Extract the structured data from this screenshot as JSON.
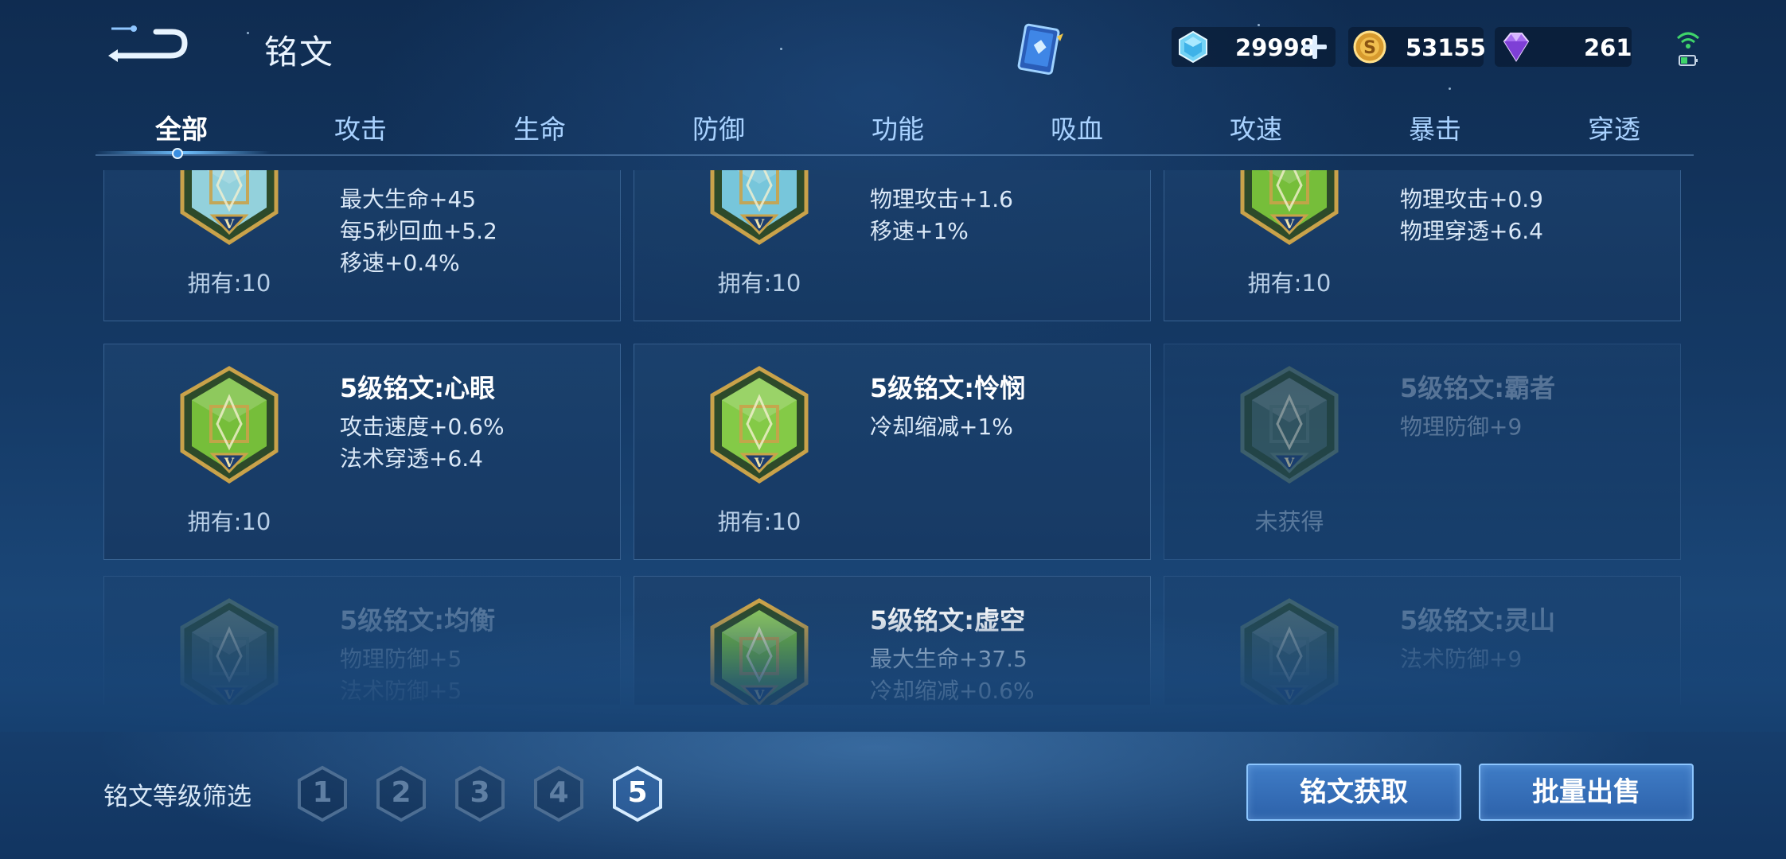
{
  "header": {
    "title": "铭文",
    "currencies": [
      {
        "name": "diamond",
        "icon": "diamond-icon",
        "value": "29998",
        "has_plus": true
      },
      {
        "name": "gold",
        "icon": "gold-coin-icon",
        "value": "53155",
        "has_plus": false
      },
      {
        "name": "gem",
        "icon": "purple-gem-icon",
        "value": "261",
        "has_plus": false
      }
    ]
  },
  "tabs": [
    {
      "label": "全部",
      "active": true
    },
    {
      "label": "攻击",
      "active": false
    },
    {
      "label": "生命",
      "active": false
    },
    {
      "label": "防御",
      "active": false
    },
    {
      "label": "功能",
      "active": false
    },
    {
      "label": "吸血",
      "active": false
    },
    {
      "label": "攻速",
      "active": false
    },
    {
      "label": "暴击",
      "active": false
    },
    {
      "label": "穿透",
      "active": false
    }
  ],
  "cards": [
    {
      "name": "",
      "attrs": [
        "最大生命+45",
        "每5秒回血+5.2",
        "移速+0.4%"
      ],
      "owned": "拥有:10",
      "obtained": true,
      "gem_color": "#9fe0f0"
    },
    {
      "name": "",
      "attrs": [
        "物理攻击+1.6",
        "移速+1%"
      ],
      "owned": "拥有:10",
      "obtained": true,
      "gem_color": "#7fd4ee"
    },
    {
      "name": "",
      "attrs": [
        "物理攻击+0.9",
        "物理穿透+6.4"
      ],
      "owned": "拥有:10",
      "obtained": true,
      "gem_color": "#7ecb3c"
    },
    {
      "name": "5级铭文:心眼",
      "attrs": [
        "攻击速度+0.6%",
        "法术穿透+6.4"
      ],
      "owned": "拥有:10",
      "obtained": true,
      "gem_color": "#7ecb3c"
    },
    {
      "name": "5级铭文:怜悯",
      "attrs": [
        "冷却缩减+1%"
      ],
      "owned": "拥有:10",
      "obtained": true,
      "gem_color": "#8ed84a"
    },
    {
      "name": "5级铭文:霸者",
      "attrs": [
        "物理防御+9"
      ],
      "owned": "未获得",
      "obtained": false,
      "gem_color": "#4a6a60"
    },
    {
      "name": "5级铭文:均衡",
      "attrs": [
        "物理防御+5",
        "法术防御+5"
      ],
      "owned": "",
      "obtained": false,
      "gem_color": "#4a6a60"
    },
    {
      "name": "5级铭文:虚空",
      "attrs": [
        "最大生命+37.5",
        "冷却缩减+0.6%"
      ],
      "owned": "",
      "obtained": true,
      "gem_color": "#7ecb3c"
    },
    {
      "name": "5级铭文:灵山",
      "attrs": [
        "法术防御+9"
      ],
      "owned": "",
      "obtained": false,
      "gem_color": "#4a6a60"
    }
  ],
  "footer": {
    "filter_label": "铭文等级筛选",
    "levels": [
      {
        "label": "1",
        "active": false
      },
      {
        "label": "2",
        "active": false
      },
      {
        "label": "3",
        "active": false
      },
      {
        "label": "4",
        "active": false
      },
      {
        "label": "5",
        "active": true
      }
    ],
    "acquire_label": "铭文获取",
    "sell_label": "批量出售"
  },
  "colors": {
    "accent": "#6fc0ff",
    "button": "#3470b8",
    "gem_gold": "#c9a24a"
  }
}
